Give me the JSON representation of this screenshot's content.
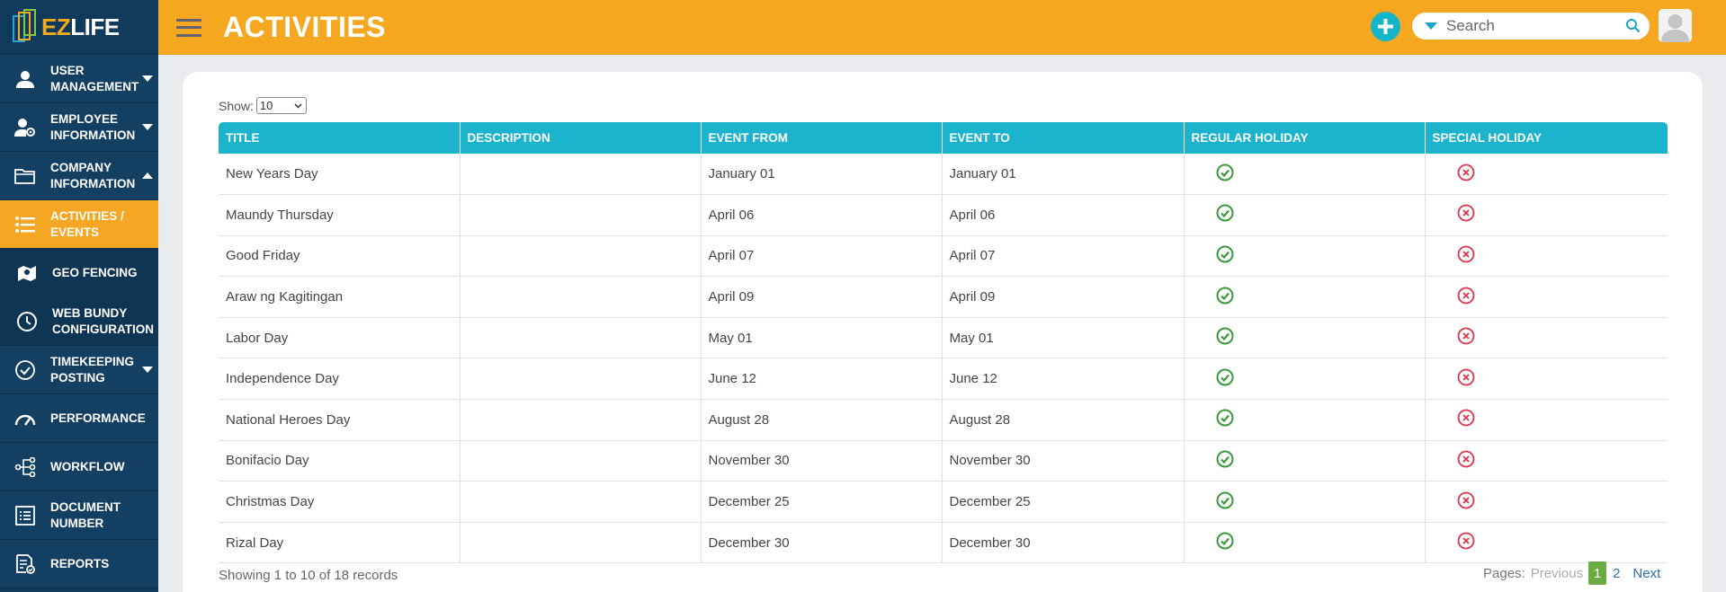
{
  "app": {
    "logo_prefix": "EZ",
    "logo_suffix": "LIFE",
    "title": "ACTIVITIES",
    "accent_color": "#f5a81f",
    "sidebar_color": "#103a5c",
    "table_header_color": "#1bb4cc"
  },
  "sidebar": {
    "items": [
      {
        "label": "USER MANAGEMENT",
        "icon": "user-icon",
        "has_caret": true
      },
      {
        "label": "EMPLOYEE INFORMATION",
        "icon": "user-gear-icon",
        "has_caret": true
      },
      {
        "label": "COMPANY INFORMATION",
        "icon": "folder-icon",
        "has_caret": true,
        "expanded": true
      },
      {
        "label": "ACTIVITIES / EVENTS",
        "icon": "list-icon",
        "active": true
      },
      {
        "label": "GEO FENCING",
        "icon": "map-pin-icon"
      },
      {
        "label": "WEB BUNDY CONFIGURATION",
        "icon": "clock-icon"
      },
      {
        "label": "TIMEKEEPING POSTING",
        "icon": "check-circle-icon",
        "has_caret": true
      },
      {
        "label": "PERFORMANCE",
        "icon": "gauge-icon"
      },
      {
        "label": "WORKFLOW",
        "icon": "workflow-icon"
      },
      {
        "label": "DOCUMENT NUMBER",
        "icon": "document-list-icon"
      },
      {
        "label": "REPORTS",
        "icon": "report-icon"
      }
    ]
  },
  "header": {
    "search_placeholder": "Search"
  },
  "table": {
    "show_label": "Show:",
    "page_size": "10",
    "columns": [
      "TITLE",
      "DESCRIPTION",
      "EVENT FROM",
      "EVENT TO",
      "REGULAR HOLIDAY",
      "SPECIAL HOLIDAY"
    ],
    "rows": [
      {
        "title": "New Years Day",
        "description": "",
        "from": "January 01",
        "to": "January 01",
        "regular": true,
        "special": false
      },
      {
        "title": "Maundy Thursday",
        "description": "",
        "from": "April 06",
        "to": "April 06",
        "regular": true,
        "special": false
      },
      {
        "title": "Good Friday",
        "description": "",
        "from": "April 07",
        "to": "April 07",
        "regular": true,
        "special": false
      },
      {
        "title": "Araw ng Kagitingan",
        "description": "",
        "from": "April 09",
        "to": "April 09",
        "regular": true,
        "special": false
      },
      {
        "title": "Labor Day",
        "description": "",
        "from": "May 01",
        "to": "May 01",
        "regular": true,
        "special": false
      },
      {
        "title": "Independence Day",
        "description": "",
        "from": "June 12",
        "to": "June 12",
        "regular": true,
        "special": false
      },
      {
        "title": "National Heroes Day",
        "description": "",
        "from": "August 28",
        "to": "August 28",
        "regular": true,
        "special": false
      },
      {
        "title": "Bonifacio Day",
        "description": "",
        "from": "November 30",
        "to": "November 30",
        "regular": true,
        "special": false
      },
      {
        "title": "Christmas Day",
        "description": "",
        "from": "December 25",
        "to": "December 25",
        "regular": true,
        "special": false
      },
      {
        "title": "Rizal Day",
        "description": "",
        "from": "December 30",
        "to": "December 30",
        "regular": true,
        "special": false
      }
    ],
    "footer": "Showing 1 to 10 of 18 records"
  },
  "pagination": {
    "label": "Pages:",
    "previous": "Previous",
    "current": "1",
    "page2": "2",
    "next": "Next"
  }
}
